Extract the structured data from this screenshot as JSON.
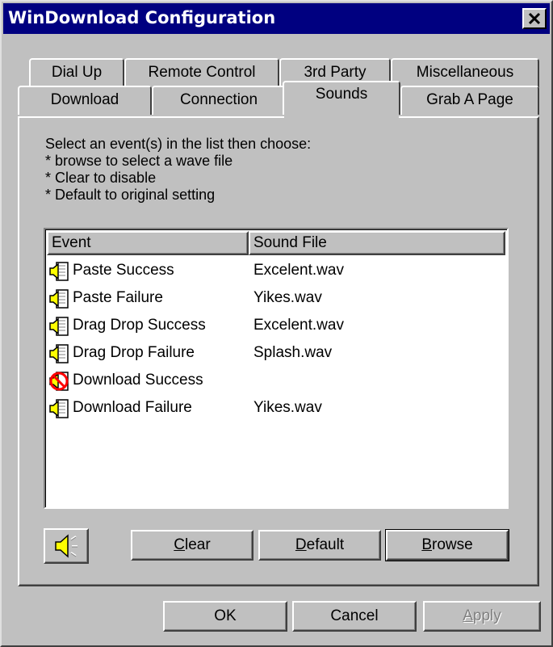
{
  "window": {
    "title": "WinDownload Configuration",
    "close_glyph": "✕"
  },
  "tabs": {
    "row1": [
      "Dial Up",
      "Remote Control",
      "3rd Party",
      "Miscellaneous"
    ],
    "row2": [
      "Download",
      "Connection",
      "Sounds",
      "Grab A Page"
    ],
    "selected": "Sounds"
  },
  "instructions": [
    "Select an event(s) in the list then choose:",
    "* browse to select a wave file",
    "* Clear to disable",
    "* Default to original setting"
  ],
  "list": {
    "columns": [
      "Event",
      "Sound File"
    ],
    "rows": [
      {
        "event": "Paste Success",
        "sound": "Excelent.wav",
        "icon": "speaker-icon"
      },
      {
        "event": "Paste Failure",
        "sound": "Yikes.wav",
        "icon": "speaker-icon"
      },
      {
        "event": "Drag Drop Success",
        "sound": "Excelent.wav",
        "icon": "speaker-icon"
      },
      {
        "event": "Drag Drop Failure",
        "sound": "Splash.wav",
        "icon": "speaker-icon"
      },
      {
        "event": "Download Success",
        "sound": "",
        "icon": "speaker-disabled-icon"
      },
      {
        "event": "Download Failure",
        "sound": "Yikes.wav",
        "icon": "speaker-icon"
      }
    ]
  },
  "sound_buttons": {
    "play_icon": "speaker-play-icon",
    "clear": {
      "first": "C",
      "rest": "lear"
    },
    "default": {
      "first": "D",
      "rest": "efault"
    },
    "browse": {
      "first": "B",
      "rest": "rowse"
    }
  },
  "dialog_buttons": {
    "ok": "OK",
    "cancel": "Cancel",
    "apply": {
      "first": "A",
      "rest": "pply"
    }
  },
  "colors": {
    "titlebar": "#000080",
    "face": "#c0c0c0",
    "speaker": "#ffff00",
    "disabled_mark": "#ff0000"
  }
}
